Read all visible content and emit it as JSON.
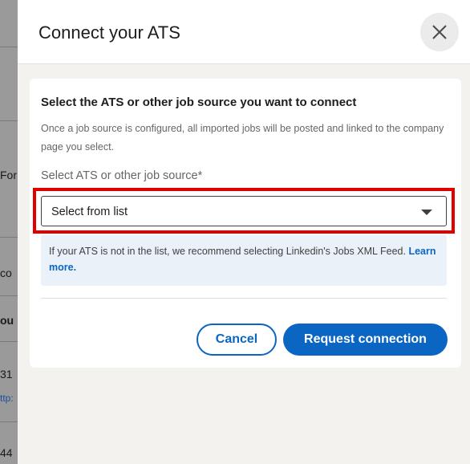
{
  "background_fragments": [
    "For",
    "co",
    "ou",
    "31",
    "ttp:",
    "44"
  ],
  "modal": {
    "title": "Connect your ATS",
    "close_icon": "close-icon",
    "heading": "Select the ATS or other job source you want to connect",
    "description": "Once a job source is configured, all imported jobs will be posted and linked to the company page you select.",
    "field_label": "Select ATS or other job source*",
    "select": {
      "value": "Select from list",
      "icon": "caret-down-icon"
    },
    "info": {
      "text": "If your ATS is not in the list, we recommend selecting Linkedin's Jobs XML Feed.",
      "link": "Learn more."
    },
    "buttons": {
      "cancel": "Cancel",
      "primary": "Request connection"
    }
  },
  "colors": {
    "accent": "#0a66c2",
    "highlight": "#e00000",
    "info_bg": "#eaf1f8"
  }
}
